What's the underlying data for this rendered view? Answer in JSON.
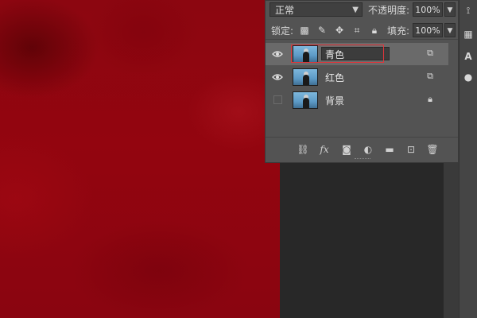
{
  "layers_panel": {
    "blend_mode": "正常",
    "opacity_label": "不透明度:",
    "opacity_value": "100%",
    "lock_label": "锁定:",
    "fill_label": "填充:",
    "fill_value": "100%",
    "layers": [
      {
        "name": "青色",
        "visible": true,
        "selected": true,
        "badge": "link-icon"
      },
      {
        "name": "红色",
        "visible": true,
        "selected": false,
        "badge": "link-icon"
      },
      {
        "name": "背景",
        "visible": false,
        "selected": false,
        "badge": "lock-icon"
      }
    ],
    "footer_fx": "fx"
  },
  "colors": {
    "canvas": "#8c0610",
    "panel": "#535353",
    "selected_row": "#6a6a6a",
    "highlight": "#e0353b"
  }
}
